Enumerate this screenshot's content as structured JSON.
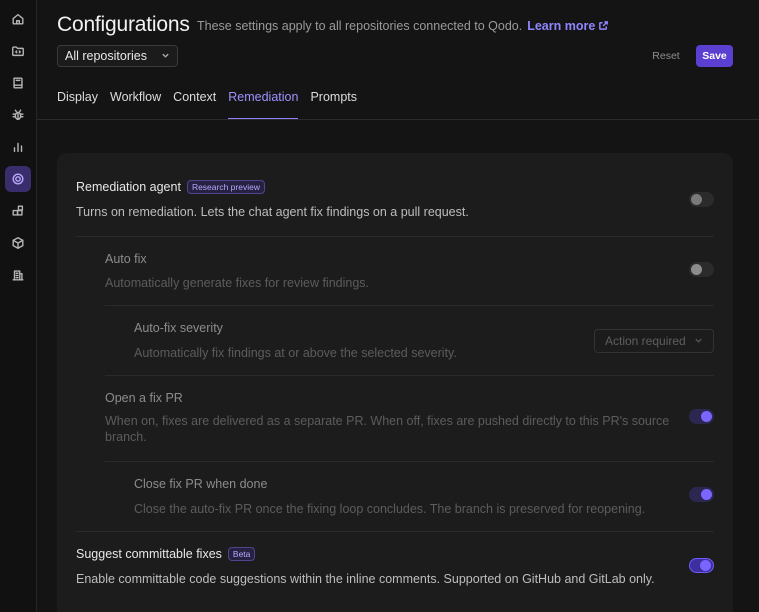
{
  "sidebar": {
    "icons": [
      "home-icon",
      "folder-code-icon",
      "book-icon",
      "bug-icon",
      "bar-chart-icon",
      "settings-icon",
      "blocks-icon",
      "package-icon",
      "building-icon"
    ],
    "active": "settings-icon"
  },
  "header": {
    "title": "Configurations",
    "subtitle": "These settings apply to all repositories connected to Qodo.",
    "learn_more": "Learn more",
    "repo_select": "All repositories",
    "reset_label": "Reset",
    "save_label": "Save"
  },
  "tabs": [
    {
      "label": "Display"
    },
    {
      "label": "Workflow"
    },
    {
      "label": "Context"
    },
    {
      "label": "Remediation",
      "active": true
    },
    {
      "label": "Prompts"
    }
  ],
  "settings": {
    "remediation_agent": {
      "title": "Remediation agent",
      "badge": "Research preview",
      "desc": "Turns on remediation. Lets the chat agent fix findings on a pull request.",
      "enabled": false
    },
    "auto_fix": {
      "title": "Auto fix",
      "desc": "Automatically generate fixes for review findings.",
      "enabled": false
    },
    "auto_fix_severity": {
      "title": "Auto-fix severity",
      "desc": "Automatically fix findings at or above the selected severity.",
      "selected": "Action required"
    },
    "open_fix_pr": {
      "title": "Open a fix PR",
      "desc_line1": "When on, fixes are delivered as a separate PR. When off, fixes are pushed directly to this PR's source",
      "desc_line2": "branch.",
      "enabled": true
    },
    "close_fix_pr": {
      "title": "Close fix PR when done",
      "desc": "Close the auto-fix PR once the fixing loop concludes. The branch is preserved for reopening.",
      "enabled": true
    },
    "suggest_committable": {
      "title": "Suggest committable fixes",
      "badge": "Beta",
      "desc": "Enable committable code suggestions within the inline comments. Supported on GitHub and GitLab only.",
      "enabled": true
    }
  },
  "colors": {
    "accent": "#5a3fd1",
    "link": "#8f86ff",
    "background": "#141414",
    "card": "#1c1c1c"
  }
}
